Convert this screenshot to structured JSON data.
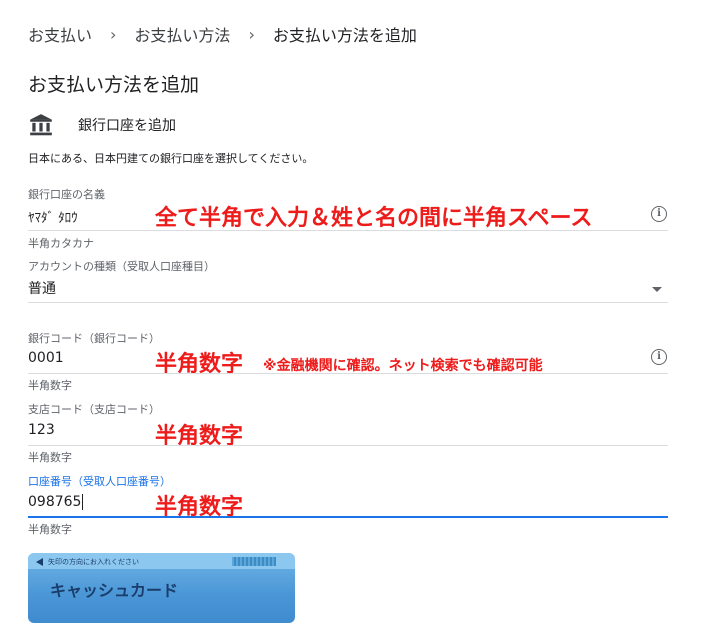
{
  "breadcrumb": {
    "items": [
      "お支払い",
      "お支払い方法",
      "お支払い方法を追加"
    ],
    "separator": "›"
  },
  "page_title": "お支払い方法を追加",
  "bank": {
    "icon": "bank-icon",
    "label": "銀行口座を追加",
    "description": "日本にある、日本円建ての銀行口座を選択してください。"
  },
  "fields": {
    "account_name": {
      "label": "銀行口座の名義",
      "value": "ﾔﾏﾀﾞ ﾀﾛｳ",
      "helper": "半角カタカナ",
      "annotation": "全て半角で入力＆姓と名の間に半角スペース"
    },
    "account_type": {
      "label": "アカウントの種類（受取人口座種目）",
      "value": "普通"
    },
    "bank_code": {
      "label": "銀行コード（銀行コード）",
      "value": "0001",
      "helper": "半角数字",
      "annotation": "半角数字",
      "annotation_note": "※金融機関に確認。ネット検索でも確認可能"
    },
    "branch_code": {
      "label": "支店コード（支店コード）",
      "value": "123",
      "helper": "半角数字",
      "annotation": "半角数字"
    },
    "account_number": {
      "label": "口座番号（受取人口座番号）",
      "value": "098765",
      "helper": "半角数字",
      "annotation": "半角数字"
    }
  },
  "card": {
    "notice": "矢印の方向にお入れください",
    "name": "キャッシュカード"
  },
  "colors": {
    "annotation": "#ee1b1b",
    "focus": "#1a73e8",
    "label": "#5f6368",
    "card": "#4a96d6"
  }
}
